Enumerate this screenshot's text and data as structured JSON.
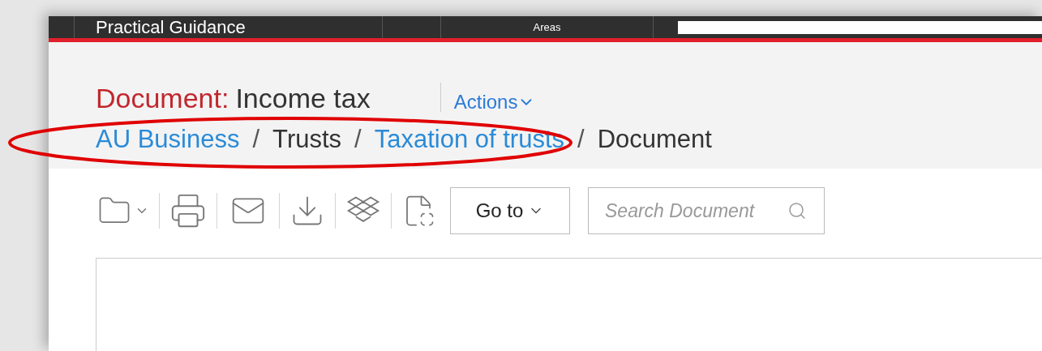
{
  "top_bar": {
    "title": "Practical Guidance",
    "menu_item": "Areas"
  },
  "document": {
    "label": "Document:",
    "title": "Income tax",
    "actions": "Actions"
  },
  "breadcrumb_separators": [
    "/",
    "/",
    "/"
  ],
  "breadcrumbs": [
    {
      "label": "AU Business",
      "kind": "link"
    },
    {
      "label": "Trusts",
      "kind": "text"
    },
    {
      "label": "Taxation of trusts",
      "kind": "link"
    },
    {
      "label": "Document",
      "kind": "text"
    }
  ],
  "toolbar": {
    "goto": "Go to",
    "search": {
      "placeholder": "Search Document"
    }
  }
}
